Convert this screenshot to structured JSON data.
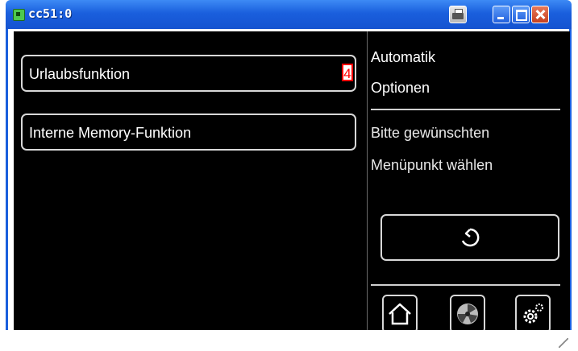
{
  "window": {
    "title": "cc51:0",
    "icons": [
      "app-icon",
      "printer-icon",
      "minimize-icon",
      "maximize-icon",
      "close-icon"
    ]
  },
  "menu": {
    "items": [
      {
        "label": "Urlaubsfunktion",
        "badge": "4"
      },
      {
        "label": "Interne Memory-Funktion"
      }
    ]
  },
  "side": {
    "title_line1": "Automatik",
    "title_line2": "Optionen",
    "hint_line1": "Bitte gewünschten",
    "hint_line2": "Menüpunkt wählen"
  },
  "buttons": {
    "back_icon": "back-arrow-icon",
    "bottom_icons": [
      "home-icon",
      "fan-icon",
      "settings-gear-icon"
    ]
  },
  "colors": {
    "screen_bg": "#000000",
    "titlebar": "#1a5fdd",
    "badge": "#ff0000",
    "text": "#ffffff"
  }
}
